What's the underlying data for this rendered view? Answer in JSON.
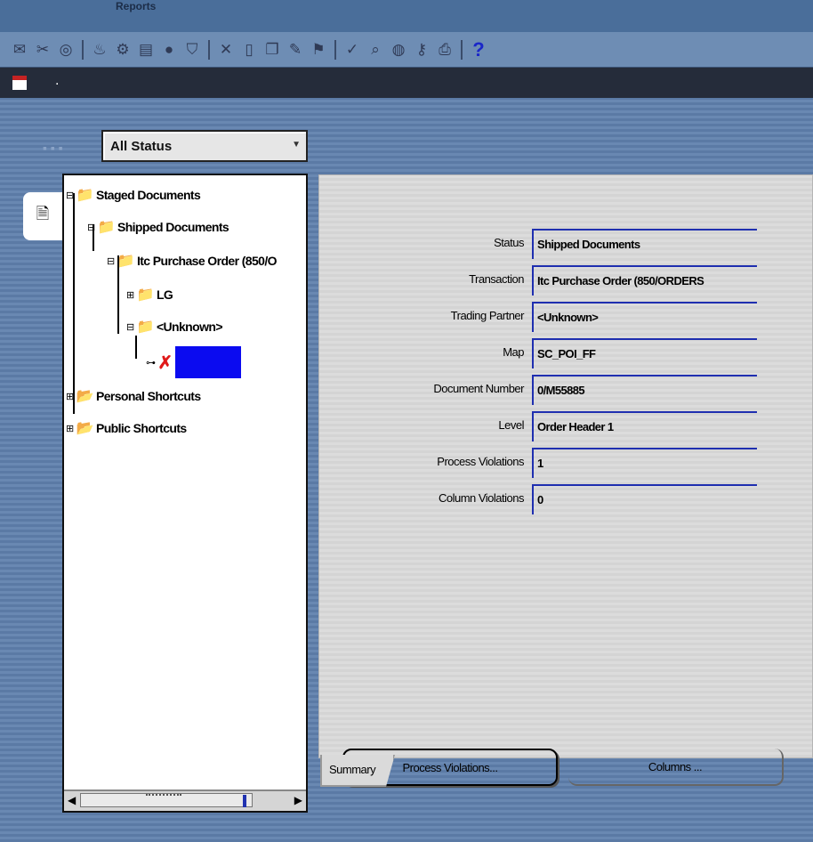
{
  "menu": {
    "label": "Reports"
  },
  "toolbar": {
    "groups": [
      [
        "envelope-icon",
        "scissors-icon",
        "target-icon"
      ],
      [
        "flame-icon",
        "gear-icon",
        "stack-icon",
        "bomb-icon",
        "shield-icon"
      ],
      [
        "cut-icon",
        "document-icon",
        "copy-icon",
        "pencil-icon",
        "flag-icon"
      ],
      [
        "check-icon",
        "search-icon",
        "globe-icon",
        "key-icon",
        "printer-icon"
      ]
    ],
    "help_label": "?"
  },
  "filter": {
    "selected": "All Status"
  },
  "tree": {
    "root": "Staged Documents",
    "shipped": "Shipped Documents",
    "transaction": "Itc Purchase Order (850/O",
    "node_lg": "LG",
    "node_unknown": "<Unknown>",
    "personal": "Personal Shortcuts",
    "public": "Public Shortcuts"
  },
  "details": [
    {
      "label": "Status",
      "value": "Shipped Documents"
    },
    {
      "label": "Transaction",
      "value": "Itc Purchase Order (850/ORDERS"
    },
    {
      "label": "Trading Partner",
      "value": "<Unknown>"
    },
    {
      "label": "Map",
      "value": "SC_POI_FF"
    },
    {
      "label": "Document Number",
      "value": "0/M55885"
    },
    {
      "label": "Level",
      "value": "Order Header 1"
    },
    {
      "label": "Process Violations",
      "value": "1"
    },
    {
      "label": "Column Violations",
      "value": "0"
    }
  ],
  "buttons": {
    "process_violations": "Process Violations...",
    "columns": "Columns ..."
  },
  "tabs": {
    "summary": "Summary"
  },
  "colors": {
    "selection": "#0b0bf0",
    "error": "#e01919",
    "toolbar": "#6e8db4",
    "titlebar": "#252c3a"
  }
}
